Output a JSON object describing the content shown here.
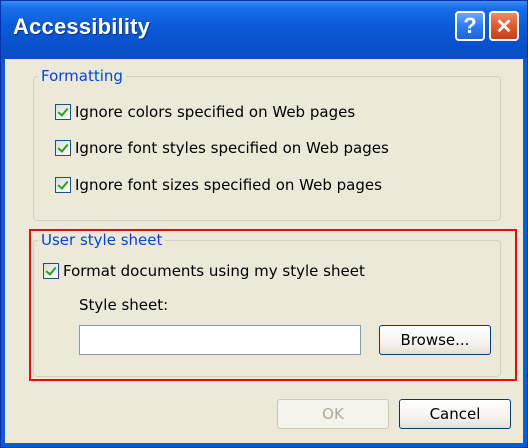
{
  "window": {
    "title": "Accessibility",
    "help_glyph": "?",
    "close_glyph": "✕"
  },
  "formatting": {
    "legend": "Formatting",
    "options": [
      {
        "label": "Ignore colors specified on Web pages",
        "checked": true
      },
      {
        "label": "Ignore font styles specified on Web pages",
        "checked": true
      },
      {
        "label": "Ignore font sizes specified on Web pages",
        "checked": true
      }
    ]
  },
  "user_style_sheet": {
    "legend": "User style sheet",
    "format_option": {
      "label": "Format documents using my style sheet",
      "checked": true
    },
    "style_sheet_label": "Style sheet:",
    "style_sheet_value": "",
    "browse_label": "Browse..."
  },
  "buttons": {
    "ok_label": "OK",
    "ok_enabled": false,
    "cancel_label": "Cancel"
  },
  "colors": {
    "titlebar": "#0a5ad8",
    "dialog_bg": "#ece9d8",
    "legend_text": "#0046d5",
    "highlight_box": "#e01010",
    "checkmark": "#21a121"
  }
}
